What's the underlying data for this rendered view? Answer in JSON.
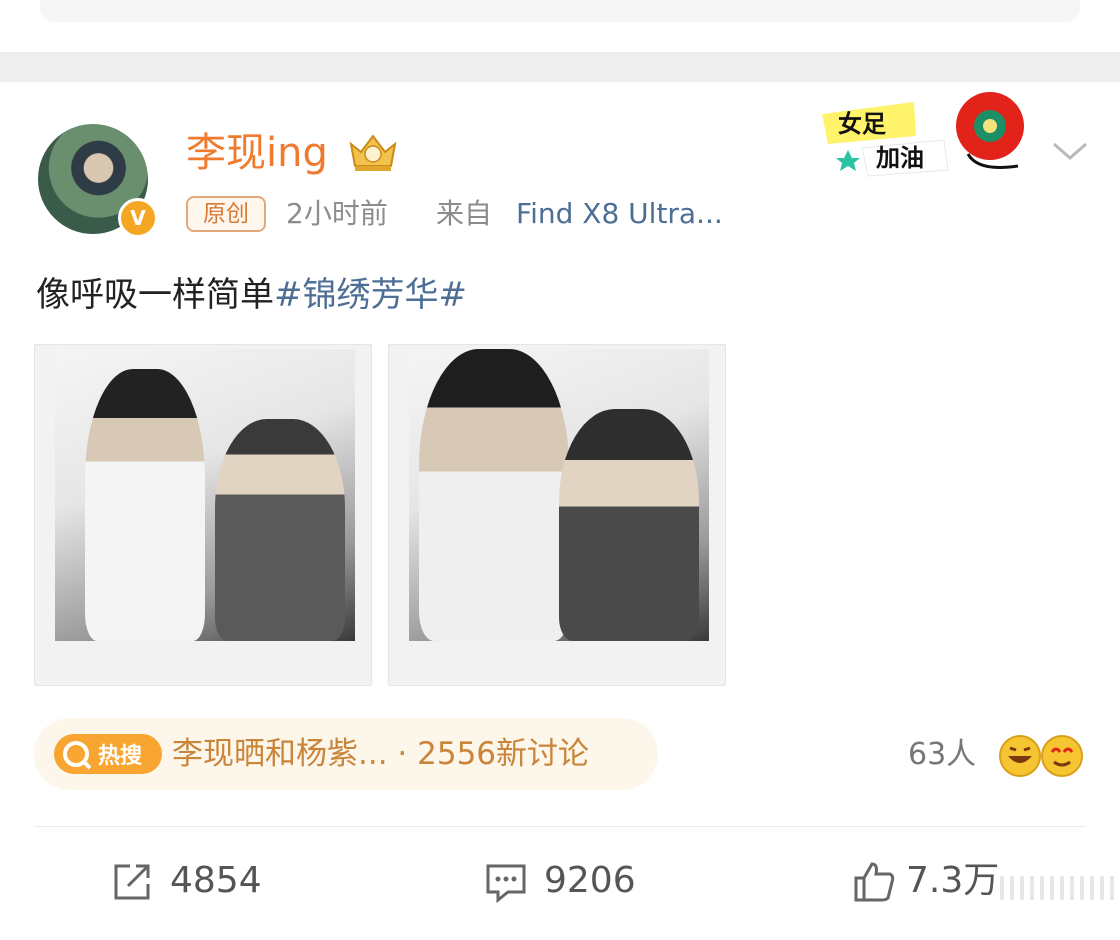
{
  "post": {
    "username": "李现ing",
    "original_label": "原创",
    "time": "2小时前",
    "from_label": "来自",
    "device": "Find X8 Ultra...",
    "text_plain": "像呼吸一样简单",
    "text_tag": "#锦绣芳华#"
  },
  "sticker": {
    "line1": "女足",
    "line2": "加油"
  },
  "hot_search": {
    "badge": "热搜",
    "text": "李现晒和杨紫... · 2556新讨论"
  },
  "reactions": {
    "count_label": "63人"
  },
  "actions": {
    "repost_count": "4854",
    "comment_count": "9206",
    "like_count": "7.3万"
  },
  "colors": {
    "username": "#f07a2f",
    "link": "#4e6f95",
    "hot_text": "#c9853a"
  }
}
